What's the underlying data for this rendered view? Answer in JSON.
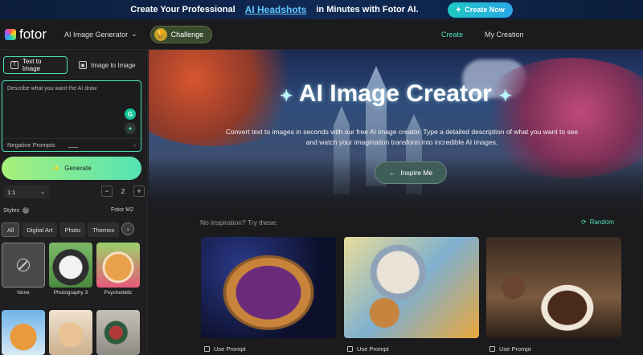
{
  "banner": {
    "text_before": "Create Your Professional",
    "highlight": "AI Headshots",
    "text_after": "in Minutes with Fotor AI.",
    "cta_label": "Create Now"
  },
  "nav": {
    "logo_text": "fotor",
    "menu_label": "AI Image Generator",
    "challenge_label": "Challenge",
    "create_label": "Create",
    "my_creation_label": "My Creation"
  },
  "sidebar": {
    "tabs": [
      {
        "label": "Text to Image",
        "active": true
      },
      {
        "label": "Image to Image",
        "active": false
      }
    ],
    "prompt_placeholder": "Describe what you want the AI draw",
    "negative_prompts_label": "Negative Prompts",
    "generate_label": "Generate",
    "ratio_value": "1:1",
    "count_value": "2",
    "styles_label": "Styles",
    "model_label": "Fotor M2",
    "style_chips": [
      {
        "label": "All",
        "active": true
      },
      {
        "label": "Digital Art",
        "active": false
      },
      {
        "label": "Photo",
        "active": false
      },
      {
        "label": "Themes",
        "active": false
      }
    ],
    "style_items": [
      {
        "label": "None"
      },
      {
        "label": "Photography 3"
      },
      {
        "label": "Psychedelic"
      },
      {
        "label": ""
      },
      {
        "label": ""
      },
      {
        "label": ""
      }
    ]
  },
  "hero": {
    "title": "AI Image Creator",
    "subtitle": "Convert text to images in seconds with our free AI image creator. Type a detailed description of what you want to see and watch your imagination transform into incredible AI images.",
    "inspire_label": "Inspire Me"
  },
  "gallery": {
    "no_inspiration_label": "No inspiration? Try these:",
    "random_label": "Random",
    "use_prompt_label": "Use Prompt"
  },
  "colors": {
    "accent": "#4fe0b5",
    "banner_bg": "#0b1d3a",
    "generate_gradient_start": "#a8f07a",
    "generate_gradient_end": "#55e3b4"
  }
}
